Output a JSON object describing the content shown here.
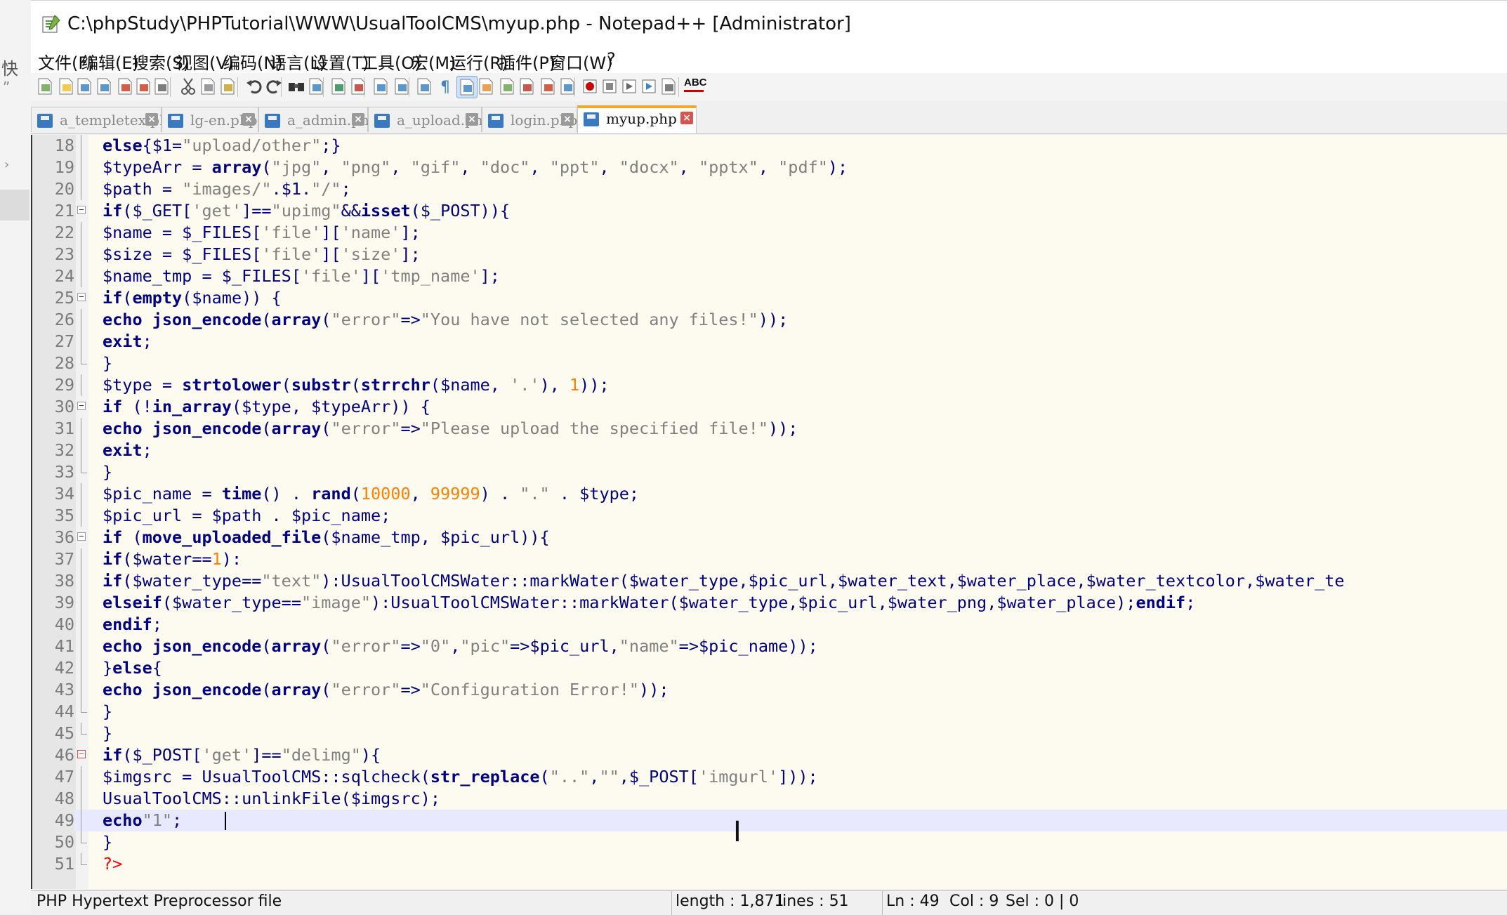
{
  "outer": {
    "char_fast": "快",
    "char_quote": "”",
    "arrow": "›"
  },
  "window": {
    "title": "C:\\phpStudy\\PHPTutorial\\WWW\\UsualToolCMS\\myup.php - Notepad++ [Administrator]"
  },
  "menu": [
    "文件(F)",
    "编辑(E)",
    "搜索(S)",
    "视图(V)",
    "编码(N)",
    "语言(L)",
    "设置(T)",
    "工具(O)",
    "宏(M)",
    "运行(R)",
    "插件(P)",
    "窗口(W)",
    "?"
  ],
  "toolbar": {
    "icons": [
      "new-icon",
      "open-icon",
      "save-icon",
      "save-all-icon",
      "close-icon",
      "close-all-icon",
      "print-icon",
      "cut-icon",
      "copy-icon",
      "paste-icon",
      "undo-icon",
      "redo-icon",
      "find-icon",
      "replace-icon",
      "zoom-in-icon",
      "zoom-out-icon",
      "sync-vertical-icon",
      "sync-horizontal-icon",
      "word-wrap-icon",
      "show-all-chars-icon",
      "indent-guide-icon",
      "user-defined-lang-icon",
      "doc-map-icon",
      "function-list-icon",
      "folder-workspace-icon",
      "monitor-icon",
      "record-macro-icon",
      "stop-record-icon",
      "play-macro-icon",
      "run-macro-multiple-icon",
      "save-macro-icon",
      "spell-check-icon"
    ],
    "spellcheck_label": "ABC"
  },
  "tabs": [
    {
      "label": "a_templetex.php",
      "active": false
    },
    {
      "label": "lg-en.php",
      "active": false
    },
    {
      "label": "a_admin.php",
      "active": false
    },
    {
      "label": "a_upload.php",
      "active": false
    },
    {
      "label": "login.php",
      "active": false
    },
    {
      "label": "myup.php",
      "active": true
    }
  ],
  "colors": {
    "keyword": "#000080",
    "string": "#808080",
    "number": "#ff8000",
    "tag": "#ff0000",
    "active_tab": "#f7a528"
  },
  "editor": {
    "current_line": 49,
    "lines": [
      {
        "n": "18",
        "fold": "line",
        "tokens": [
          [
            "k",
            "else"
          ],
          [
            "o",
            "{$1="
          ],
          [
            "s",
            "\"upload/other\""
          ],
          [
            "o",
            ";}"
          ]
        ]
      },
      {
        "n": "19",
        "fold": "line",
        "tokens": [
          [
            "o",
            "$typeArr = "
          ],
          [
            "k",
            "array"
          ],
          [
            "o",
            "("
          ],
          [
            "s",
            "\"jpg\""
          ],
          [
            "o",
            ", "
          ],
          [
            "s",
            "\"png\""
          ],
          [
            "o",
            ", "
          ],
          [
            "s",
            "\"gif\""
          ],
          [
            "o",
            ", "
          ],
          [
            "s",
            "\"doc\""
          ],
          [
            "o",
            ", "
          ],
          [
            "s",
            "\"ppt\""
          ],
          [
            "o",
            ", "
          ],
          [
            "s",
            "\"docx\""
          ],
          [
            "o",
            ", "
          ],
          [
            "s",
            "\"pptx\""
          ],
          [
            "o",
            ", "
          ],
          [
            "s",
            "\"pdf\""
          ],
          [
            "o",
            ");"
          ]
        ]
      },
      {
        "n": "20",
        "fold": "line",
        "tokens": [
          [
            "o",
            "$path = "
          ],
          [
            "s",
            "\"images/\""
          ],
          [
            "o",
            "."
          ],
          [
            "o",
            "$1."
          ],
          [
            "s",
            "\"/\""
          ],
          [
            "o",
            ";"
          ]
        ]
      },
      {
        "n": "21",
        "fold": "box",
        "tokens": [
          [
            "k",
            "if"
          ],
          [
            "o",
            "($_GET["
          ],
          [
            "s",
            "'get'"
          ],
          [
            "o",
            "]=="
          ],
          [
            "s",
            "\"upimg\""
          ],
          [
            "o",
            "&&"
          ],
          [
            "k",
            "isset"
          ],
          [
            "o",
            "($_POST)){"
          ]
        ]
      },
      {
        "n": "22",
        "fold": "line",
        "tokens": [
          [
            "o",
            "$name = $_FILES["
          ],
          [
            "s",
            "'file'"
          ],
          [
            "o",
            "]["
          ],
          [
            "s",
            "'name'"
          ],
          [
            "o",
            "];"
          ]
        ]
      },
      {
        "n": "23",
        "fold": "line",
        "tokens": [
          [
            "o",
            "$size = $_FILES["
          ],
          [
            "s",
            "'file'"
          ],
          [
            "o",
            "]["
          ],
          [
            "s",
            "'size'"
          ],
          [
            "o",
            "];"
          ]
        ]
      },
      {
        "n": "24",
        "fold": "line",
        "tokens": [
          [
            "o",
            "$name_tmp = $_FILES["
          ],
          [
            "s",
            "'file'"
          ],
          [
            "o",
            "]["
          ],
          [
            "s",
            "'tmp_name'"
          ],
          [
            "o",
            "];"
          ]
        ]
      },
      {
        "n": "25",
        "fold": "box",
        "tokens": [
          [
            "k",
            "if"
          ],
          [
            "o",
            "("
          ],
          [
            "k",
            "empty"
          ],
          [
            "o",
            "($name)) {"
          ]
        ]
      },
      {
        "n": "26",
        "fold": "line",
        "tokens": [
          [
            "k",
            "echo json_encode"
          ],
          [
            "o",
            "("
          ],
          [
            "k",
            "array"
          ],
          [
            "o",
            "("
          ],
          [
            "s",
            "\"error\""
          ],
          [
            "o",
            "=>"
          ],
          [
            "s",
            "\"You have not selected any files!\""
          ],
          [
            "o",
            "));"
          ]
        ]
      },
      {
        "n": "27",
        "fold": "line",
        "tokens": [
          [
            "k",
            "exit"
          ],
          [
            "o",
            ";"
          ]
        ]
      },
      {
        "n": "28",
        "fold": "end",
        "tokens": [
          [
            "o",
            "}"
          ]
        ]
      },
      {
        "n": "29",
        "fold": "line",
        "tokens": [
          [
            "o",
            "$type = "
          ],
          [
            "k",
            "strtolower"
          ],
          [
            "o",
            "("
          ],
          [
            "k",
            "substr"
          ],
          [
            "o",
            "("
          ],
          [
            "k",
            "strrchr"
          ],
          [
            "o",
            "($name, "
          ],
          [
            "s",
            "'.'"
          ],
          [
            "o",
            "), "
          ],
          [
            "n",
            "1"
          ],
          [
            "o",
            "));"
          ]
        ]
      },
      {
        "n": "30",
        "fold": "box",
        "tokens": [
          [
            "k",
            "if"
          ],
          [
            "o",
            " (!"
          ],
          [
            "k",
            "in_array"
          ],
          [
            "o",
            "($type, $typeArr)) {"
          ]
        ]
      },
      {
        "n": "31",
        "fold": "line",
        "tokens": [
          [
            "k",
            "echo json_encode"
          ],
          [
            "o",
            "("
          ],
          [
            "k",
            "array"
          ],
          [
            "o",
            "("
          ],
          [
            "s",
            "\"error\""
          ],
          [
            "o",
            "=>"
          ],
          [
            "s",
            "\"Please upload the specified file!\""
          ],
          [
            "o",
            "));"
          ]
        ]
      },
      {
        "n": "32",
        "fold": "line",
        "tokens": [
          [
            "k",
            "exit"
          ],
          [
            "o",
            ";"
          ]
        ]
      },
      {
        "n": "33",
        "fold": "end",
        "tokens": [
          [
            "o",
            "}"
          ]
        ]
      },
      {
        "n": "34",
        "fold": "line",
        "tokens": [
          [
            "o",
            "$pic_name = "
          ],
          [
            "k",
            "time"
          ],
          [
            "o",
            "() . "
          ],
          [
            "k",
            "rand"
          ],
          [
            "o",
            "("
          ],
          [
            "n",
            "10000"
          ],
          [
            "o",
            ", "
          ],
          [
            "n",
            "99999"
          ],
          [
            "o",
            ") . "
          ],
          [
            "s",
            "\".\""
          ],
          [
            "o",
            " . $type;"
          ]
        ]
      },
      {
        "n": "35",
        "fold": "line",
        "tokens": [
          [
            "o",
            "$pic_url = $path . $pic_name;"
          ]
        ]
      },
      {
        "n": "36",
        "fold": "box",
        "tokens": [
          [
            "k",
            "if"
          ],
          [
            "o",
            " ("
          ],
          [
            "k",
            "move_uploaded_file"
          ],
          [
            "o",
            "($name_tmp, $pic_url)){"
          ]
        ]
      },
      {
        "n": "37",
        "fold": "line",
        "tokens": [
          [
            "k",
            "if"
          ],
          [
            "o",
            "($water=="
          ],
          [
            "n",
            "1"
          ],
          [
            "o",
            "):"
          ]
        ]
      },
      {
        "n": "38",
        "fold": "line",
        "tokens": [
          [
            "k",
            "if"
          ],
          [
            "o",
            "($water_type=="
          ],
          [
            "s",
            "\"text\""
          ],
          [
            "o",
            "):UsualToolCMSWater::markWater($water_type,$pic_url,$water_text,$water_place,$water_textcolor,$water_te"
          ]
        ]
      },
      {
        "n": "39",
        "fold": "line",
        "tokens": [
          [
            "k",
            "elseif"
          ],
          [
            "o",
            "($water_type=="
          ],
          [
            "s",
            "\"image\""
          ],
          [
            "o",
            "):UsualToolCMSWater::markWater($water_type,$pic_url,$water_png,$water_place);"
          ],
          [
            "k",
            "endif"
          ],
          [
            "o",
            ";"
          ]
        ]
      },
      {
        "n": "40",
        "fold": "line",
        "tokens": [
          [
            "k",
            "endif"
          ],
          [
            "o",
            ";"
          ]
        ]
      },
      {
        "n": "41",
        "fold": "line",
        "tokens": [
          [
            "k",
            "echo json_encode"
          ],
          [
            "o",
            "("
          ],
          [
            "k",
            "array"
          ],
          [
            "o",
            "("
          ],
          [
            "s",
            "\"error\""
          ],
          [
            "o",
            "=>"
          ],
          [
            "s",
            "\"0\""
          ],
          [
            "o",
            ","
          ],
          [
            "s",
            "\"pic\""
          ],
          [
            "o",
            "=>$pic_url,"
          ],
          [
            "s",
            "\"name\""
          ],
          [
            "o",
            "=>$pic_name));"
          ]
        ]
      },
      {
        "n": "42",
        "fold": "line",
        "tokens": [
          [
            "o",
            "}"
          ],
          [
            "k",
            "else"
          ],
          [
            "o",
            "{"
          ]
        ]
      },
      {
        "n": "43",
        "fold": "line",
        "tokens": [
          [
            "k",
            "echo json_encode"
          ],
          [
            "o",
            "("
          ],
          [
            "k",
            "array"
          ],
          [
            "o",
            "("
          ],
          [
            "s",
            "\"error\""
          ],
          [
            "o",
            "=>"
          ],
          [
            "s",
            "\"Configuration Error!\""
          ],
          [
            "o",
            "));"
          ]
        ]
      },
      {
        "n": "44",
        "fold": "end",
        "tokens": [
          [
            "o",
            "}"
          ]
        ]
      },
      {
        "n": "45",
        "fold": "end",
        "tokens": [
          [
            "o",
            "}"
          ]
        ]
      },
      {
        "n": "46",
        "fold": "boxred",
        "tokens": [
          [
            "k",
            "if"
          ],
          [
            "o",
            "($_POST["
          ],
          [
            "s",
            "'get'"
          ],
          [
            "o",
            "]=="
          ],
          [
            "s",
            "\"delimg\""
          ],
          [
            "o",
            "){"
          ]
        ]
      },
      {
        "n": "47",
        "fold": "line",
        "tokens": [
          [
            "o",
            "$imgsrc = UsualToolCMS::sqlcheck("
          ],
          [
            "k",
            "str_replace"
          ],
          [
            "o",
            "("
          ],
          [
            "s",
            "\"..\""
          ],
          [
            "o",
            ","
          ],
          [
            "s",
            "\"\""
          ],
          [
            "o",
            ",$_POST["
          ],
          [
            "s",
            "'imgurl'"
          ],
          [
            "o",
            "]));"
          ]
        ]
      },
      {
        "n": "48",
        "fold": "line",
        "tokens": [
          [
            "o",
            "UsualToolCMS::unlinkFile($imgsrc);"
          ]
        ]
      },
      {
        "n": "49",
        "fold": "line",
        "tokens": [
          [
            "k",
            "echo"
          ],
          [
            "s",
            "\"1\""
          ],
          [
            "o",
            ";"
          ]
        ]
      },
      {
        "n": "50",
        "fold": "end",
        "tokens": [
          [
            "o",
            "}"
          ]
        ]
      },
      {
        "n": "51",
        "fold": "endlast",
        "tokens": [
          [
            "t",
            "?>"
          ]
        ]
      }
    ]
  },
  "status": {
    "file_type": "PHP Hypertext Preprocessor file",
    "length": "length : 1,871",
    "lines": "lines : 51",
    "ln": "Ln : 49",
    "col": "Col : 9",
    "sel": "Sel : 0 | 0"
  }
}
